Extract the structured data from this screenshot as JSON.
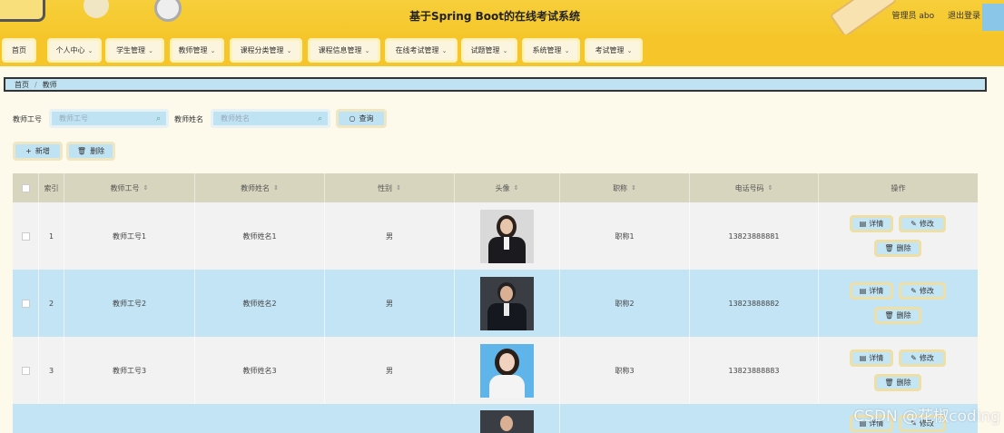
{
  "header": {
    "title": "基于Spring Boot的在线考试系统",
    "user_label": "管理员 abo",
    "logout_label": "退出登录"
  },
  "nav": {
    "items": [
      {
        "label": "首页",
        "dropdown": false
      },
      {
        "label": "个人中心",
        "dropdown": true
      },
      {
        "label": "学生管理",
        "dropdown": true
      },
      {
        "label": "教师管理",
        "dropdown": true
      },
      {
        "label": "课程分类管理",
        "dropdown": true
      },
      {
        "label": "课程信息管理",
        "dropdown": true
      },
      {
        "label": "在线考试管理",
        "dropdown": true
      },
      {
        "label": "试题管理",
        "dropdown": true
      },
      {
        "label": "系统管理",
        "dropdown": true
      },
      {
        "label": "考试管理",
        "dropdown": true
      }
    ]
  },
  "breadcrumb": {
    "home": "首页",
    "current": "教师"
  },
  "search": {
    "teacher_no_label": "教师工号",
    "teacher_no_placeholder": "教师工号",
    "teacher_name_label": "教师姓名",
    "teacher_name_placeholder": "教师姓名",
    "query_label": "查询"
  },
  "actions": {
    "add_label": "新增",
    "delete_label": "删除"
  },
  "table": {
    "columns": [
      "索引",
      "教师工号",
      "教师姓名",
      "性别",
      "头像",
      "职称",
      "电话号码",
      "操作"
    ],
    "rows": [
      {
        "index": "1",
        "teacher_no": "教师工号1",
        "teacher_name": "教师姓名1",
        "gender": "男",
        "title": "职称1",
        "phone": "13823888881"
      },
      {
        "index": "2",
        "teacher_no": "教师工号2",
        "teacher_name": "教师姓名2",
        "gender": "男",
        "title": "职称2",
        "phone": "13823888882"
      },
      {
        "index": "3",
        "teacher_no": "教师工号3",
        "teacher_name": "教师姓名3",
        "gender": "男",
        "title": "职称3",
        "phone": "13823888883"
      }
    ],
    "row_actions": {
      "detail": "详情",
      "edit": "修改",
      "delete": "删除"
    }
  },
  "watermark": "CSDN @花椒coding",
  "colors": {
    "header": "#f6c52a",
    "accent": "#bfe3f3",
    "row_even": "#c2e4f5"
  }
}
